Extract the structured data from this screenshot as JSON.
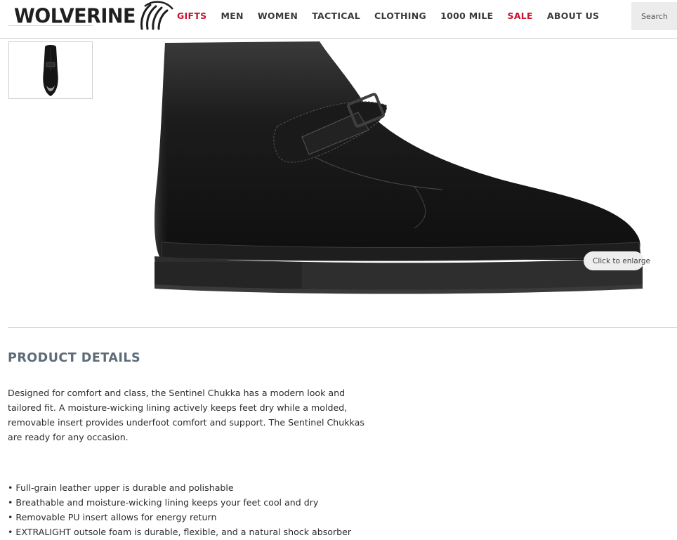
{
  "header": {
    "logo_text": "WOLVERINE",
    "nav": [
      {
        "label": "GIFTS",
        "highlight": true
      },
      {
        "label": "MEN",
        "highlight": false
      },
      {
        "label": "WOMEN",
        "highlight": false
      },
      {
        "label": "TACTICAL",
        "highlight": false
      },
      {
        "label": "CLOTHING",
        "highlight": false
      },
      {
        "label": "1000 MILE",
        "highlight": false
      },
      {
        "label": "SALE",
        "highlight": true
      },
      {
        "label": "ABOUT US",
        "highlight": false
      }
    ],
    "search": {
      "placeholder": "Search"
    }
  },
  "gallery": {
    "enlarge_label": "Click to enlarge"
  },
  "details": {
    "title": "PRODUCT DETAILS",
    "description": "Designed for comfort and class, the Sentinel Chukka has a modern look and tailored fit. A moisture-wicking lining actively keeps feet dry while a molded, removable insert provides underfoot comfort and support. The Sentinel Chukkas are ready for any occasion.",
    "features": [
      "• Full-grain leather upper is durable and polishable",
      "• Breathable and moisture-wicking lining keeps your feet cool and dry",
      "• Removable PU insert allows for energy return",
      "• EXTRALIGHT outsole foam is durable, flexible, and a natural shock absorber"
    ]
  },
  "colors": {
    "accent_red": "#c8102e",
    "title_slate": "#5d6b78"
  }
}
